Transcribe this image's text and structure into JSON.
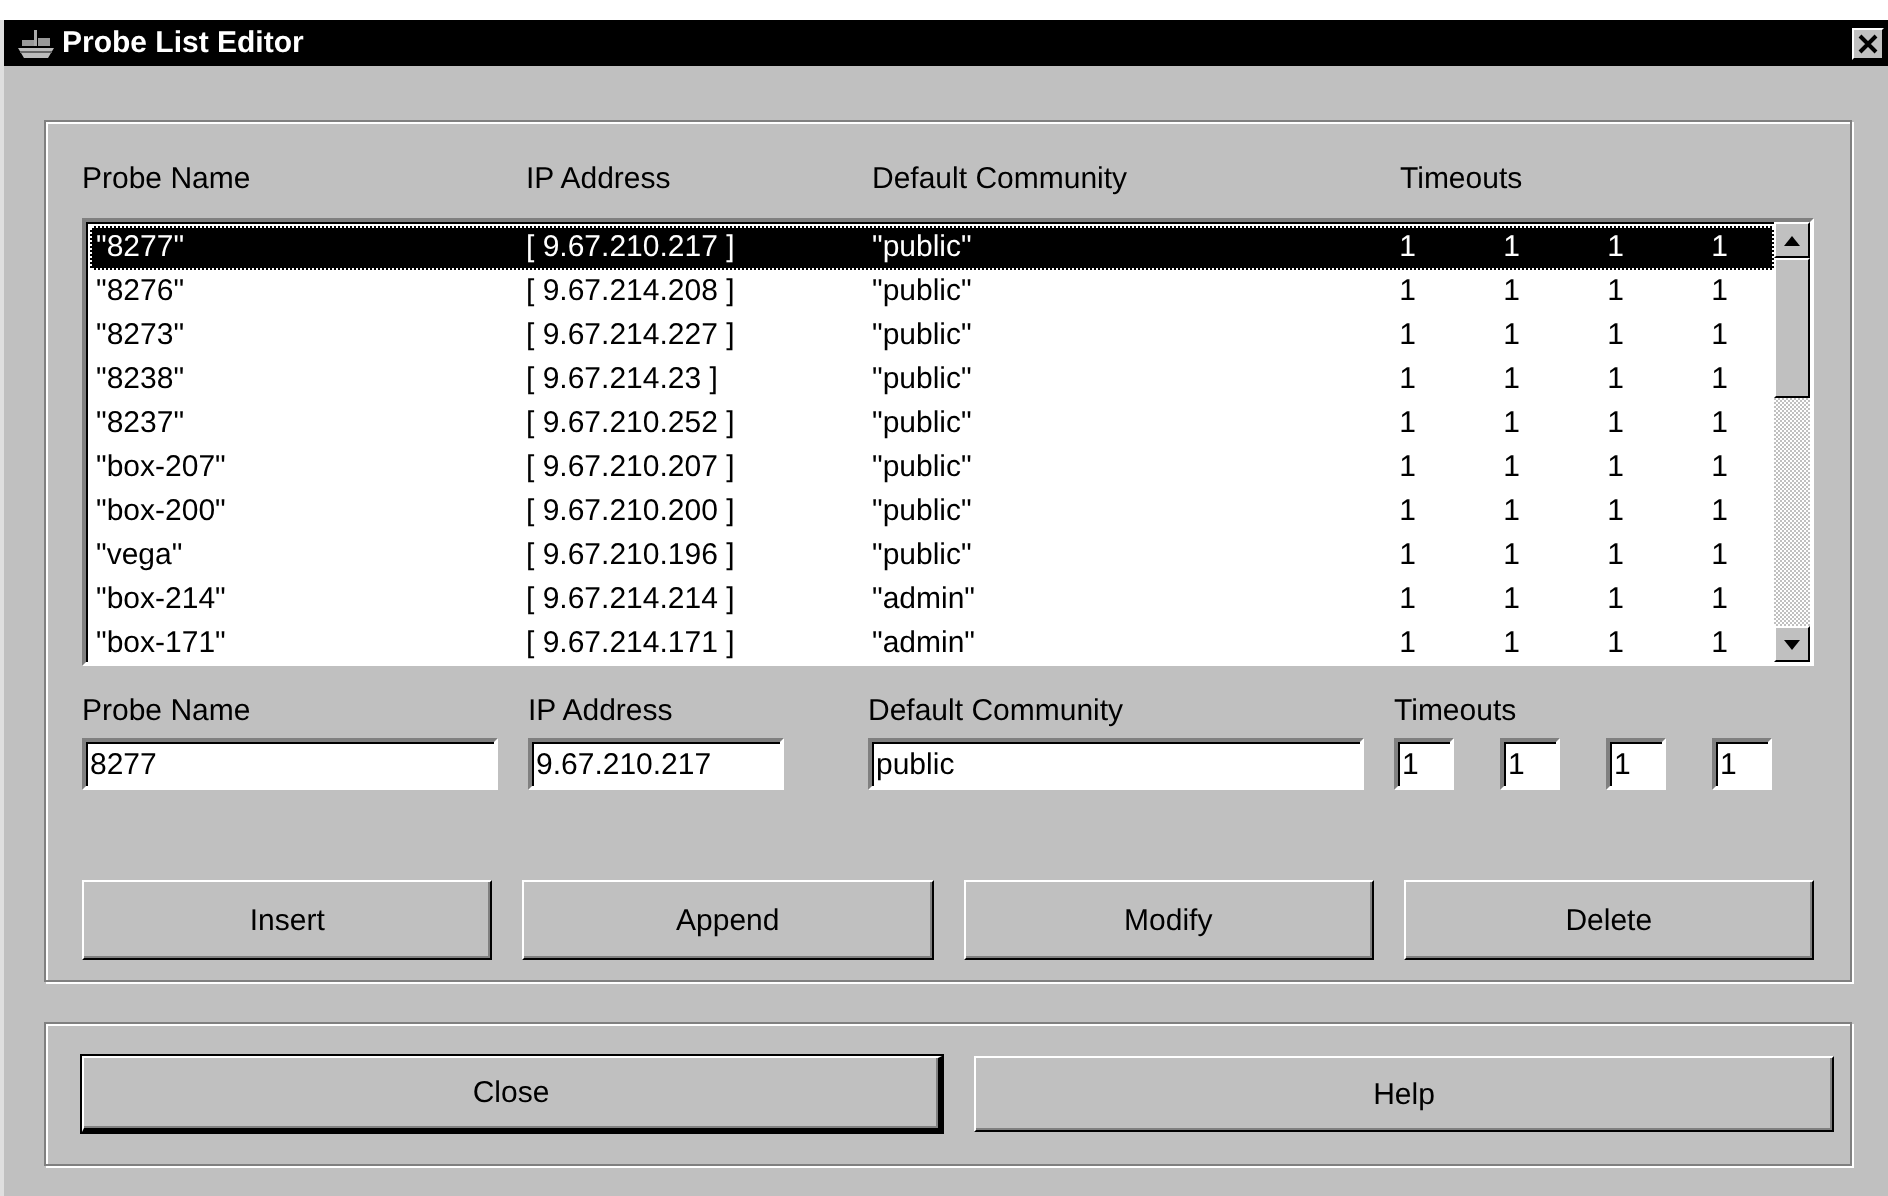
{
  "window": {
    "title": "Probe List Editor"
  },
  "list": {
    "columns": [
      {
        "label": "Probe Name"
      },
      {
        "label": "IP Address"
      },
      {
        "label": "Default Community"
      },
      {
        "label": "Timeouts"
      }
    ],
    "rows": [
      {
        "name": "\"8277\"",
        "ip": "[ 9.67.210.217 ]",
        "community": "\"public\"",
        "timeouts": [
          "1",
          "1",
          "1",
          "1"
        ],
        "selected": true
      },
      {
        "name": "\"8276\"",
        "ip": "[ 9.67.214.208 ]",
        "community": "\"public\"",
        "timeouts": [
          "1",
          "1",
          "1",
          "1"
        ],
        "selected": false
      },
      {
        "name": "\"8273\"",
        "ip": "[ 9.67.214.227 ]",
        "community": "\"public\"",
        "timeouts": [
          "1",
          "1",
          "1",
          "1"
        ],
        "selected": false
      },
      {
        "name": "\"8238\"",
        "ip": "[ 9.67.214.23 ]",
        "community": "\"public\"",
        "timeouts": [
          "1",
          "1",
          "1",
          "1"
        ],
        "selected": false
      },
      {
        "name": "\"8237\"",
        "ip": "[ 9.67.210.252 ]",
        "community": "\"public\"",
        "timeouts": [
          "1",
          "1",
          "1",
          "1"
        ],
        "selected": false
      },
      {
        "name": "\"box-207\"",
        "ip": "[ 9.67.210.207 ]",
        "community": "\"public\"",
        "timeouts": [
          "1",
          "1",
          "1",
          "1"
        ],
        "selected": false
      },
      {
        "name": "\"box-200\"",
        "ip": "[ 9.67.210.200 ]",
        "community": "\"public\"",
        "timeouts": [
          "1",
          "1",
          "1",
          "1"
        ],
        "selected": false
      },
      {
        "name": "\"vega\"",
        "ip": "[ 9.67.210.196 ]",
        "community": "\"public\"",
        "timeouts": [
          "1",
          "1",
          "1",
          "1"
        ],
        "selected": false
      },
      {
        "name": "\"box-214\"",
        "ip": "[ 9.67.214.214 ]",
        "community": "\"admin\"",
        "timeouts": [
          "1",
          "1",
          "1",
          "1"
        ],
        "selected": false
      },
      {
        "name": "\"box-171\"",
        "ip": "[ 9.67.214.171 ]",
        "community": "\"admin\"",
        "timeouts": [
          "1",
          "1",
          "1",
          "1"
        ],
        "selected": false
      }
    ]
  },
  "form": {
    "fields": [
      {
        "label": "Probe Name",
        "value": "8277"
      },
      {
        "label": "IP Address",
        "value": "9.67.210.217"
      },
      {
        "label": "Default Community",
        "value": "public"
      }
    ],
    "timeouts": {
      "label": "Timeouts",
      "values": [
        "1",
        "1",
        "1",
        "1"
      ]
    }
  },
  "buttons": [
    {
      "label": "Insert"
    },
    {
      "label": "Append"
    },
    {
      "label": "Modify"
    },
    {
      "label": "Delete"
    }
  ],
  "footer_buttons": [
    {
      "label": "Close",
      "default": true
    },
    {
      "label": "Help",
      "default": false
    }
  ]
}
